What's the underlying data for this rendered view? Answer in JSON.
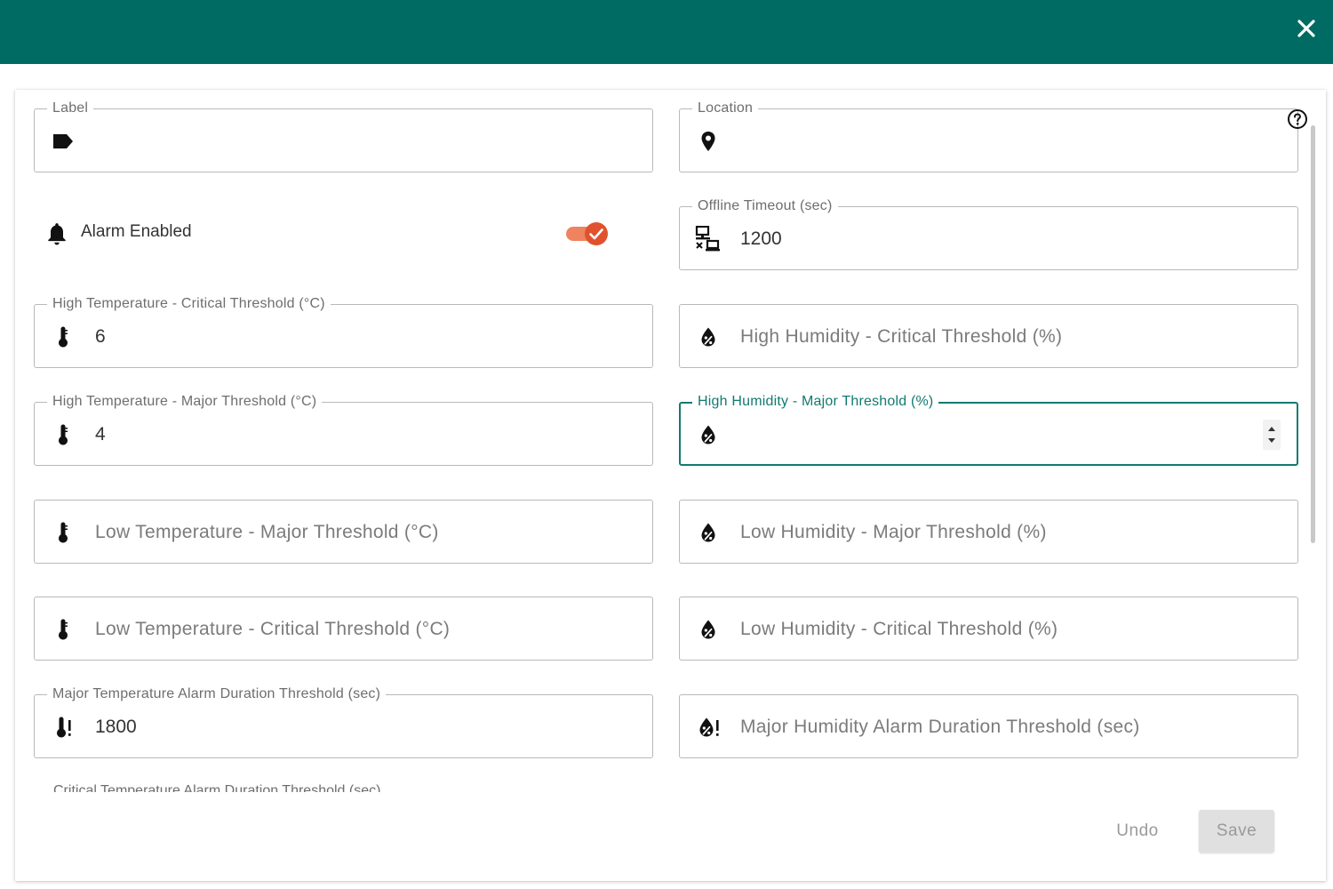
{
  "dialog": {
    "close_icon": "close-icon"
  },
  "form": {
    "label_field": {
      "label": "Label",
      "value": "",
      "icon": "tag-icon"
    },
    "location_field": {
      "label": "Location",
      "value": "",
      "icon": "map-pin-icon"
    },
    "alarm_enabled": {
      "label": "Alarm Enabled",
      "checked": true,
      "icon": "bell-icon"
    },
    "offline_timeout": {
      "label": "Offline Timeout (sec)",
      "value": "1200",
      "icon": "network-offline-icon"
    },
    "high_temp_critical": {
      "label": "High Temperature - Critical Threshold (°C)",
      "value": "6",
      "icon": "thermometer-icon"
    },
    "high_humidity_critical": {
      "placeholder": "High Humidity - Critical Threshold (%)",
      "icon": "humidity-icon"
    },
    "high_temp_major": {
      "label": "High Temperature - Major Threshold (°C)",
      "value": "4",
      "icon": "thermometer-icon"
    },
    "high_humidity_major": {
      "label": "High Humidity - Major Threshold (%)",
      "value": "",
      "icon": "humidity-icon"
    },
    "low_temp_major": {
      "placeholder": "Low Temperature - Major Threshold (°C)",
      "icon": "thermometer-icon"
    },
    "low_humidity_major": {
      "placeholder": "Low Humidity - Major Threshold (%)",
      "icon": "humidity-icon"
    },
    "low_temp_critical": {
      "placeholder": "Low Temperature - Critical Threshold (°C)",
      "icon": "thermometer-icon"
    },
    "low_humidity_critical": {
      "placeholder": "Low Humidity - Critical Threshold (%)",
      "icon": "humidity-icon"
    },
    "major_temp_duration": {
      "label": "Major Temperature Alarm Duration Threshold (sec)",
      "value": "1800",
      "icon": "thermometer-alert-icon"
    },
    "major_humidity_duration": {
      "placeholder": "Major Humidity Alarm Duration Threshold (sec)",
      "icon": "humidity-alert-icon"
    },
    "critical_temp_duration": {
      "label": "Critical Temperature Alarm Duration Threshold (sec)"
    }
  },
  "actions": {
    "undo_label": "Undo",
    "save_label": "Save"
  },
  "colors": {
    "header": "#006b62",
    "accent": "#117a70",
    "toggle": "#e0522e"
  }
}
